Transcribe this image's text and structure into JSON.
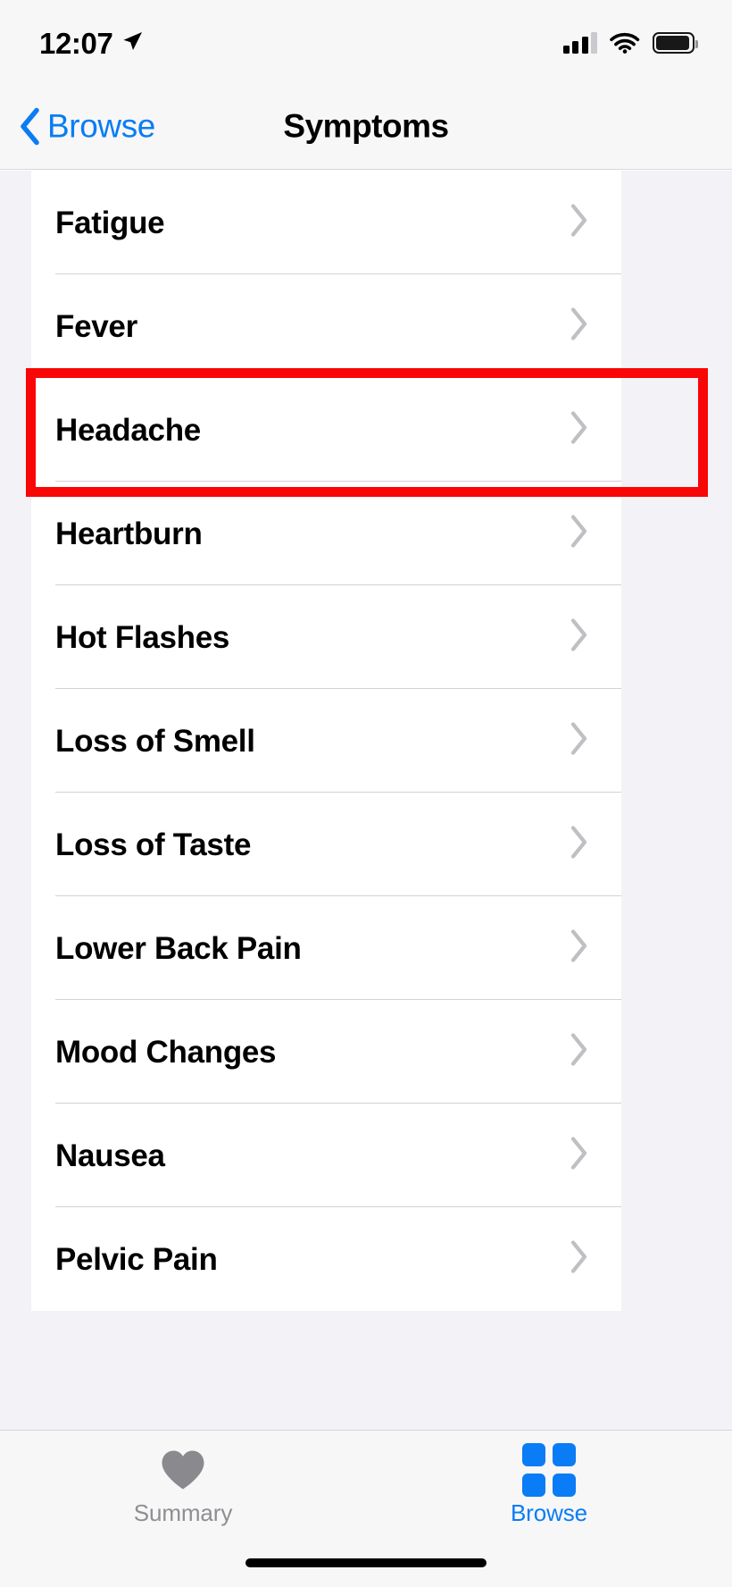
{
  "status_bar": {
    "time": "12:07",
    "location_icon": "location-arrow-icon",
    "cellular_icon": "cellular-signal-icon",
    "cellular_bars_filled": 3,
    "cellular_bars_total": 4,
    "wifi_icon": "wifi-icon",
    "battery_icon": "battery-icon",
    "battery_level_percent": 94
  },
  "nav_bar": {
    "back_label": "Browse",
    "back_icon": "chevron-left-icon",
    "title": "Symptoms"
  },
  "list": {
    "rows": [
      {
        "label": "Fatigue",
        "chevron": "chevron-right-icon",
        "highlighted": false
      },
      {
        "label": "Fever",
        "chevron": "chevron-right-icon",
        "highlighted": false
      },
      {
        "label": "Headache",
        "chevron": "chevron-right-icon",
        "highlighted": true
      },
      {
        "label": "Heartburn",
        "chevron": "chevron-right-icon",
        "highlighted": false
      },
      {
        "label": "Hot Flashes",
        "chevron": "chevron-right-icon",
        "highlighted": false
      },
      {
        "label": "Loss of Smell",
        "chevron": "chevron-right-icon",
        "highlighted": false
      },
      {
        "label": "Loss of Taste",
        "chevron": "chevron-right-icon",
        "highlighted": false
      },
      {
        "label": "Lower Back Pain",
        "chevron": "chevron-right-icon",
        "highlighted": false
      },
      {
        "label": "Mood Changes",
        "chevron": "chevron-right-icon",
        "highlighted": false
      },
      {
        "label": "Nausea",
        "chevron": "chevron-right-icon",
        "highlighted": false
      },
      {
        "label": "Pelvic Pain",
        "chevron": "chevron-right-icon",
        "highlighted": false
      }
    ]
  },
  "highlight": {
    "target_label": "Headache",
    "color": "#f90606"
  },
  "tab_bar": {
    "tabs": [
      {
        "label": "Summary",
        "icon": "heart-icon",
        "active": false
      },
      {
        "label": "Browse",
        "icon": "grid-squares-icon",
        "active": true
      }
    ]
  },
  "colors": {
    "accent_blue": "#0a7cf5",
    "inactive_gray": "#8e8e93",
    "highlight_red": "#f90606",
    "background_gray": "#f2f2f7",
    "bar_gray": "#f7f7f7",
    "separator": "#d3d3d8"
  }
}
